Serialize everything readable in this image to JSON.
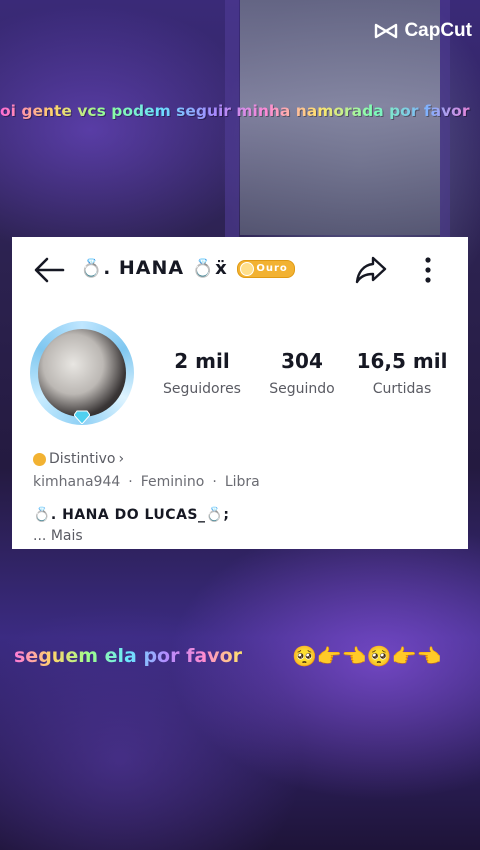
{
  "watermark": {
    "brand": "CapCut",
    "icon": "capcut-logo-icon"
  },
  "captions": {
    "top": "oi gente vcs podem seguir minha namorada por favor",
    "bottom": "seguem ela por favor",
    "bottom_emojis": "🥺👉👈🥺👉👈"
  },
  "profile": {
    "title_prefix": "💍.",
    "title": "HANA",
    "title_suffix": "💍ẍ",
    "badge_label": "Ouro",
    "followers_value": "2 mil",
    "followers_label": "Seguidores",
    "following_value": "304",
    "following_label": "Seguindo",
    "likes_value": "16,5 mil",
    "likes_label": "Curtidas",
    "distintivo_label": "Distintivo",
    "username": "kimhana944",
    "gender": "Feminino",
    "sign": "Libra",
    "bio": "💍. HANA DO LUCAS_💍;",
    "more_prefix": "...",
    "more_label": "Mais"
  },
  "colors": {
    "badge_gold": "#f2b232",
    "avatar_frame": "#7fc7f0",
    "text_primary": "#161823",
    "text_secondary": "#5a5b63"
  }
}
